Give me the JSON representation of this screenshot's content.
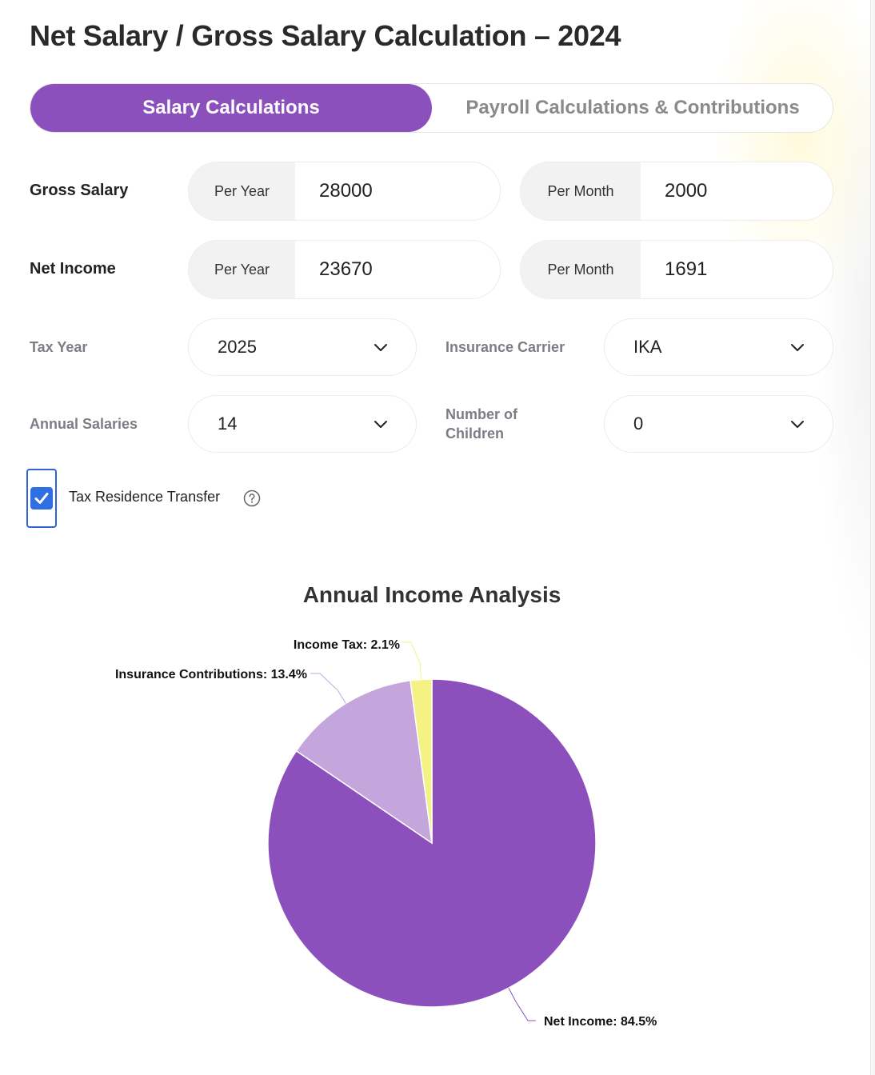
{
  "page": {
    "title": "Net Salary / Gross Salary Calculation – 2024"
  },
  "tabs": [
    {
      "label": "Salary Calculations",
      "active": true
    },
    {
      "label": "Payroll Calculations & Contributions",
      "active": false
    }
  ],
  "gross_salary": {
    "label": "Gross Salary",
    "per_year_label": "Per Year",
    "per_year_value": "28000",
    "per_month_label": "Per Month",
    "per_month_value": "2000"
  },
  "net_income": {
    "label": "Net Income",
    "per_year_label": "Per Year",
    "per_year_value": "23670",
    "per_month_label": "Per Month",
    "per_month_value": "1691"
  },
  "tax_year": {
    "label": "Tax Year",
    "value": "2025"
  },
  "insurance_carrier": {
    "label": "Insurance Carrier",
    "value": "IKA"
  },
  "annual_salaries": {
    "label": "Annual Salaries",
    "value": "14"
  },
  "children": {
    "label_line1": "Number of",
    "label_line2": "Children",
    "value": "0"
  },
  "tax_residence": {
    "label": "Tax Residence Transfer",
    "checked": true
  },
  "icons": {
    "chevron": "chevron-down-icon",
    "help": "help-circle-icon",
    "check": "checkmark-icon"
  },
  "colors": {
    "accent": "#8c50bc",
    "net_income": "#8c50bc",
    "insurance": "#c4a6dd",
    "income_tax": "#f4f284",
    "checkbox": "#2f6fe4"
  },
  "chart_data": {
    "type": "pie",
    "title": "Annual Income Analysis",
    "categories": [
      "Net Income",
      "Insurance Contributions",
      "Income Tax"
    ],
    "values": [
      84.5,
      13.4,
      2.1
    ],
    "labels": [
      "Net Income: 84.5%",
      "Insurance Contributions: 13.4%",
      "Income Tax: 2.1%"
    ],
    "colors": [
      "#8c50bc",
      "#c4a6dd",
      "#f4f284"
    ],
    "start_angle": "12 o'clock, counter-clockwise order from Net Income",
    "legend": "none"
  }
}
